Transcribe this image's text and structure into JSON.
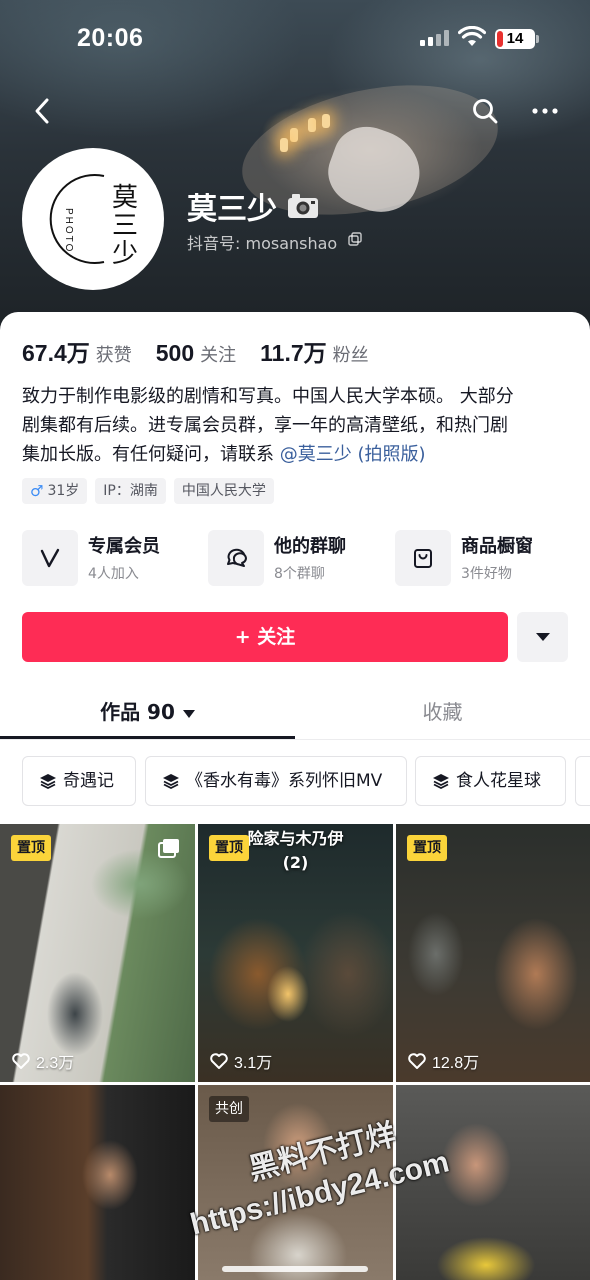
{
  "status_bar": {
    "time": "20:06",
    "battery": "14"
  },
  "profile": {
    "name": "莫三少",
    "account_id": "抖音号: mosanshao",
    "avatar_text_cn": "莫三少",
    "avatar_text_en": "PHOTO"
  },
  "stats": [
    {
      "value": "67.4万",
      "label": "获赞"
    },
    {
      "value": "500",
      "label": "关注"
    },
    {
      "value": "11.7万",
      "label": "粉丝"
    }
  ],
  "bio": {
    "line1": "致力于制作电影级的剧情和写真。中国人民大学本硕。 大部分",
    "line2": "剧集都有后续。进专属会员群，享一年的高清壁纸，和热门剧",
    "line3_prefix": "集加长版。有任何疑问，请联系",
    "mention": "@莫三少 (拍照版)"
  },
  "tags": [
    {
      "symbol": "♂",
      "label": "31岁"
    },
    {
      "label": "IP：湖南"
    },
    {
      "label": "中国人民大学"
    }
  ],
  "features": [
    {
      "title": "专属会员",
      "subtitle": "4人加入",
      "icon": "v-badge-icon"
    },
    {
      "title": "他的群聊",
      "subtitle": "8个群聊",
      "icon": "chat-bubble-icon"
    },
    {
      "title": "商品橱窗",
      "subtitle": "3件好物",
      "icon": "shopping-bag-icon"
    }
  ],
  "follow_button": "+ 关注",
  "tabs": [
    {
      "label": "作品 90",
      "active": true
    },
    {
      "label": "收藏",
      "active": false
    }
  ],
  "collections": [
    {
      "label": "奇遇记"
    },
    {
      "label": "《香水有毒》系列怀旧MV"
    },
    {
      "label": "食人花星球"
    }
  ],
  "videos": [
    {
      "badge": "置顶",
      "likes": "2.3万",
      "multi": true
    },
    {
      "badge": "置顶",
      "likes": "3.1万",
      "title": "险家与木乃伊",
      "subtitle": "(2)"
    },
    {
      "badge": "置顶",
      "likes": "12.8万"
    },
    {
      "badge": ""
    },
    {
      "badge": "共创"
    },
    {
      "badge": ""
    }
  ],
  "watermark": {
    "line1": "黑料不打烊",
    "line2": "https://ibdy24.com"
  },
  "colors": {
    "accent": "#fe2c55",
    "pin": "#fbd43a",
    "mention": "#3a5f9c"
  }
}
